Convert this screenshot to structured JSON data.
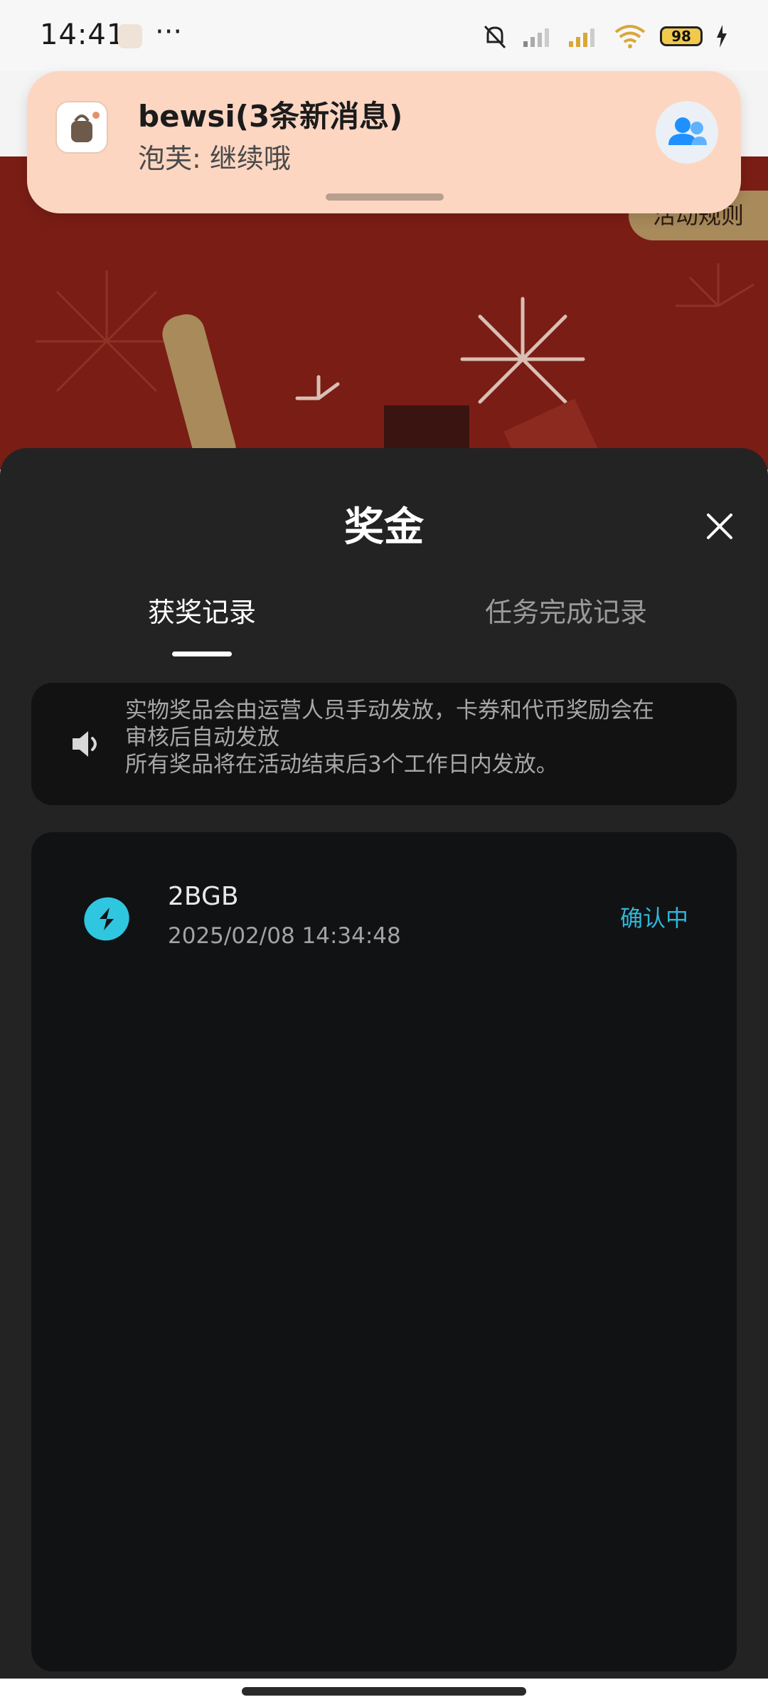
{
  "status_bar": {
    "time": "14:41",
    "more": "···",
    "battery": "98"
  },
  "notification": {
    "title": "bewsi(3条新消息)",
    "body": "泡芙: 继续哦"
  },
  "hero": {
    "rules_label": "活动规则"
  },
  "sheet": {
    "title": "奖金",
    "tabs": [
      {
        "label": "获奖记录"
      },
      {
        "label": "任务完成记录"
      }
    ],
    "notice": {
      "lines": [
        "实物奖品会由运营人员手动发放，卡券和代币奖励会在",
        "审核后自动发放",
        "所有奖品将在活动结束后3个工作日内发放。"
      ]
    },
    "records": [
      {
        "name": "2BGB",
        "time": "2025/02/08 14:34:48",
        "status": "确认中"
      }
    ]
  },
  "colors": {
    "hero_red": "#7a1d15",
    "accent_cyan": "#2fb6d8",
    "sheet_bg": "#232323",
    "notif_bg": "#fdd6c2"
  }
}
